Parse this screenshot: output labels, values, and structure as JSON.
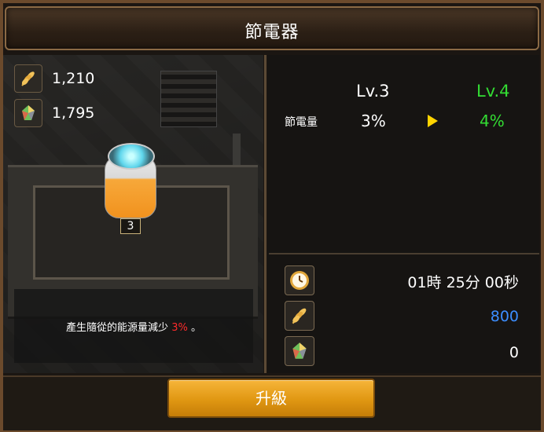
{
  "header": {
    "title": "節電器"
  },
  "resources": [
    {
      "icon": "wheat-icon",
      "value": "1,210"
    },
    {
      "icon": "crystal-icon",
      "value": "1,795"
    }
  ],
  "building": {
    "level_badge": "3"
  },
  "description": {
    "text_before": "產生隨從的能源量減少 ",
    "highlight": "3%",
    "text_after": " 。"
  },
  "upgrade_info": {
    "current_level": "Lv.3",
    "next_level": "Lv.4",
    "stat_label": "節電量",
    "stat_current": "3%",
    "stat_next": "4%"
  },
  "costs": [
    {
      "icon": "clock-icon",
      "value": "01時 25分 00秒"
    },
    {
      "icon": "wheat-icon",
      "value": "800"
    },
    {
      "icon": "crystal-icon",
      "value": "0"
    }
  ],
  "actions": {
    "upgrade_label": "升級"
  },
  "colors": {
    "next_level": "#33dd33",
    "highlight": "#ff2b2b",
    "cost_blue": "#3c8eff",
    "button": "#e09712"
  }
}
